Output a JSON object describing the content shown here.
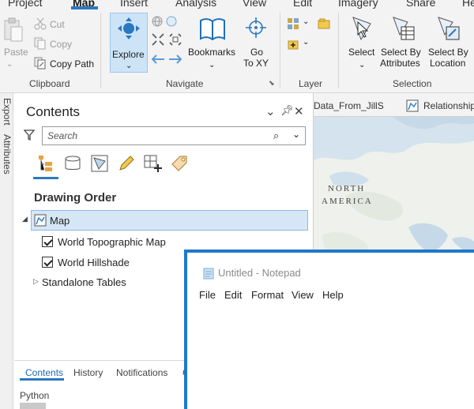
{
  "ribbon": {
    "tabs": [
      "Project",
      "Map",
      "Insert",
      "Analysis",
      "View",
      "Edit",
      "Imagery",
      "Share",
      "He"
    ],
    "active_tab": "Map",
    "clipboard": {
      "paste": "Paste",
      "cut": "Cut",
      "copy": "Copy",
      "copy_path": "Copy Path",
      "group": "Clipboard"
    },
    "navigate": {
      "explore": "Explore",
      "bookmarks": "Bookmarks",
      "go_to_xy_line1": "Go",
      "go_to_xy_line2": "To XY",
      "group": "Navigate"
    },
    "layer": {
      "group": "Layer"
    },
    "selection": {
      "select": "Select",
      "by_attributes_line1": "Select By",
      "by_attributes_line2": "Attributes",
      "by_location_line1": "Select By",
      "by_location_line2": "Location",
      "group": "Selection"
    }
  },
  "side_tabs": [
    "Export",
    "Attributes"
  ],
  "contents": {
    "title": "Contents",
    "search_placeholder": "Search",
    "heading": "Drawing Order",
    "map_item": "Map",
    "layers": [
      "World Topographic Map",
      "World Hillshade"
    ],
    "standalone": "Standalone Tables",
    "bottom_tabs": [
      "Contents",
      "History",
      "Notifications",
      "C"
    ],
    "python": "Python"
  },
  "map_view": {
    "tabs": [
      "Data_From_JillS",
      "Relationship"
    ],
    "labels": [
      "NORTH",
      "AMERICA"
    ]
  },
  "notepad": {
    "title": "Untitled - Notepad",
    "menu": [
      "File",
      "Edit",
      "Format",
      "View",
      "Help"
    ],
    "text": ""
  },
  "colors": {
    "accent": "#2b78c2",
    "selection_bg": "#d5e7f7",
    "notepad_frame": "#1f78c9"
  }
}
